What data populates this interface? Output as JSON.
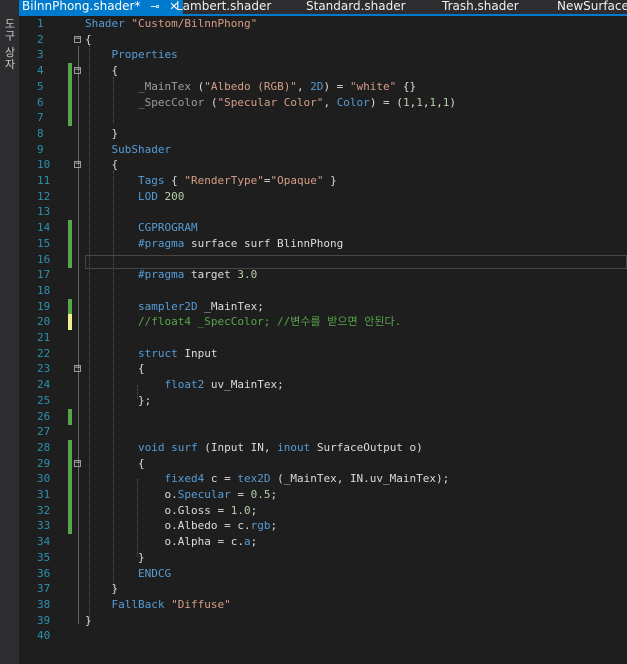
{
  "side_panel": {
    "label": "도구 상자"
  },
  "tabs": [
    {
      "label": "BilnnPhong.shader*",
      "active": true,
      "pin": "⊸",
      "close": "✕"
    },
    {
      "label": "Lambert.shader"
    },
    {
      "label": "Standard.shader"
    },
    {
      "label": "Trash.shader"
    },
    {
      "label": "NewSurfaceS"
    }
  ],
  "editor": {
    "lines": [
      {
        "n": "1",
        "t": [
          [
            "Shader ",
            "kw"
          ],
          [
            "\"Custom/BilnnPhong\"",
            "st"
          ]
        ]
      },
      {
        "n": "2",
        "t": [
          [
            "{",
            ""
          ]
        ]
      },
      {
        "n": "3",
        "t": [
          [
            "    Properties",
            "kw"
          ]
        ]
      },
      {
        "n": "4",
        "t": [
          [
            "    {",
            ""
          ]
        ]
      },
      {
        "n": "5",
        "t": [
          [
            "        _MainTex",
            "pp"
          ],
          [
            " (",
            ""
          ],
          [
            "\"Albedo (RGB)\"",
            "st"
          ],
          [
            ", ",
            ""
          ],
          [
            "2D",
            "kw"
          ],
          [
            ") = ",
            ""
          ],
          [
            "\"white\"",
            "st"
          ],
          [
            " {}",
            ""
          ]
        ]
      },
      {
        "n": "6",
        "t": [
          [
            "        _SpecColor",
            "pp"
          ],
          [
            " (",
            ""
          ],
          [
            "\"Specular Color\"",
            "st"
          ],
          [
            ", ",
            ""
          ],
          [
            "Color",
            "kw"
          ],
          [
            ") = (",
            ""
          ],
          [
            "1",
            "nm"
          ],
          [
            ",",
            ""
          ],
          [
            "1",
            "nm"
          ],
          [
            ",",
            ""
          ],
          [
            "1",
            "nm"
          ],
          [
            ",",
            ""
          ],
          [
            "1",
            "nm"
          ],
          [
            ")",
            ""
          ]
        ]
      },
      {
        "n": "7",
        "t": []
      },
      {
        "n": "8",
        "t": [
          [
            "    }",
            ""
          ]
        ]
      },
      {
        "n": "9",
        "t": [
          [
            "    SubShader",
            "kw"
          ]
        ]
      },
      {
        "n": "10",
        "t": [
          [
            "    {",
            ""
          ]
        ]
      },
      {
        "n": "11",
        "t": [
          [
            "        Tags",
            "kw"
          ],
          [
            " { ",
            ""
          ],
          [
            "\"RenderType\"",
            "st"
          ],
          [
            "=",
            ""
          ],
          [
            "\"Opaque\"",
            "st"
          ],
          [
            " }",
            ""
          ]
        ]
      },
      {
        "n": "12",
        "t": [
          [
            "        LOD ",
            "kw"
          ],
          [
            "200",
            "nm"
          ]
        ]
      },
      {
        "n": "13",
        "t": []
      },
      {
        "n": "14",
        "t": [
          [
            "        CGPROGRAM",
            "kw"
          ]
        ]
      },
      {
        "n": "15",
        "t": [
          [
            "        #pragma",
            "kw"
          ],
          [
            " surface surf BlinnPhong",
            ""
          ]
        ]
      },
      {
        "n": "16",
        "t": []
      },
      {
        "n": "17",
        "t": [
          [
            "        #pragma",
            "kw"
          ],
          [
            " target ",
            ""
          ],
          [
            "3.0",
            "nm"
          ]
        ]
      },
      {
        "n": "18",
        "t": []
      },
      {
        "n": "19",
        "t": [
          [
            "        sampler2D",
            "kw"
          ],
          [
            " _MainTex;",
            ""
          ]
        ]
      },
      {
        "n": "20",
        "t": [
          [
            "        //float4 _SpecColor; //변수를 받으면 안된다.",
            "cm"
          ]
        ]
      },
      {
        "n": "21",
        "t": []
      },
      {
        "n": "22",
        "t": [
          [
            "        struct",
            "kw"
          ],
          [
            " Input",
            ""
          ]
        ]
      },
      {
        "n": "23",
        "t": [
          [
            "        {",
            ""
          ]
        ]
      },
      {
        "n": "24",
        "t": [
          [
            "            float2",
            "kw"
          ],
          [
            " uv_MainTex;",
            ""
          ]
        ]
      },
      {
        "n": "25",
        "t": [
          [
            "        };",
            ""
          ]
        ]
      },
      {
        "n": "26",
        "t": []
      },
      {
        "n": "27",
        "t": []
      },
      {
        "n": "28",
        "t": [
          [
            "        void",
            "kw"
          ],
          [
            " ",
            ""
          ],
          [
            "surf",
            "kw"
          ],
          [
            " (Input IN, ",
            ""
          ],
          [
            "inout",
            "kw"
          ],
          [
            " SurfaceOutput o)",
            ""
          ]
        ]
      },
      {
        "n": "29",
        "t": [
          [
            "        {",
            ""
          ]
        ]
      },
      {
        "n": "30",
        "t": [
          [
            "            fixed4",
            "kw"
          ],
          [
            " c = ",
            ""
          ],
          [
            "tex2D",
            "kw"
          ],
          [
            " (_MainTex, IN.uv_MainTex);",
            ""
          ]
        ]
      },
      {
        "n": "31",
        "t": [
          [
            "            o.",
            ""
          ],
          [
            "Specular",
            "kw"
          ],
          [
            " = ",
            ""
          ],
          [
            "0.5",
            "nm"
          ],
          [
            ";",
            ""
          ]
        ]
      },
      {
        "n": "32",
        "t": [
          [
            "            o.Gloss = ",
            ""
          ],
          [
            "1.0",
            "nm"
          ],
          [
            ";",
            ""
          ]
        ]
      },
      {
        "n": "33",
        "t": [
          [
            "            o.Albedo = c.",
            ""
          ],
          [
            "rgb",
            "kw"
          ],
          [
            ";",
            ""
          ]
        ]
      },
      {
        "n": "34",
        "t": [
          [
            "            o.Alpha = c.",
            ""
          ],
          [
            "a",
            "kw"
          ],
          [
            ";",
            ""
          ]
        ]
      },
      {
        "n": "35",
        "t": [
          [
            "        }",
            ""
          ]
        ]
      },
      {
        "n": "36",
        "t": [
          [
            "        ENDCG",
            "kw"
          ]
        ]
      },
      {
        "n": "37",
        "t": [
          [
            "    }",
            ""
          ]
        ]
      },
      {
        "n": "38",
        "t": [
          [
            "    FallBack ",
            "kw"
          ],
          [
            "\"Diffuse\"",
            "st"
          ]
        ]
      },
      {
        "n": "39",
        "t": [
          [
            "}",
            ""
          ]
        ]
      },
      {
        "n": "40",
        "t": []
      }
    ],
    "colors": {
      "keyword": "#569cd6",
      "string": "#d69d85",
      "comment": "#57a64a",
      "number": "#b5cea8",
      "line_number": "#2b91af",
      "accent": "#007acc"
    }
  }
}
